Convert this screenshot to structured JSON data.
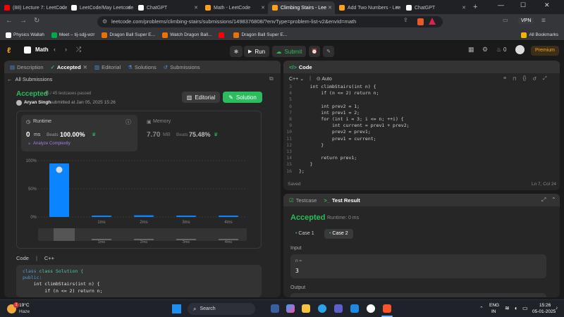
{
  "browser": {
    "tabs": [
      {
        "title": "(88) Lecture 7: LeetCode",
        "color": "#ff0000"
      },
      {
        "title": "LeetCode/May Leetcode",
        "color": "#ffffff"
      },
      {
        "title": "ChatGPT",
        "color": "#ffffff"
      },
      {
        "title": "Math - LeetCode",
        "color": "#ffa116"
      },
      {
        "title": "Climbing Stairs - Lee",
        "color": "#ffa116"
      },
      {
        "title": "Add Two Numbers - Lee",
        "color": "#ffa116"
      },
      {
        "title": "ChatGPT",
        "color": "#ffffff"
      }
    ],
    "active_tab": 4,
    "url": "leetcode.com/problems/climbing-stairs/submissions/1498376808/?envType=problem-list-v2&envId=math",
    "vpn": "VPN",
    "bookmarks": [
      "Physics Wallah",
      "Meet – tij-sdjj-wzr",
      "Dragon Ball Super E...",
      "Watch Dragon Ball...",
      "",
      "Dragon Ball Super E..."
    ],
    "all_bookmarks": "All Bookmarks"
  },
  "lc_header": {
    "title": "Math",
    "run": "Run",
    "submit": "Submit",
    "fire_count": "0",
    "premium": "Premium"
  },
  "left_panel": {
    "tabs": [
      "Description",
      "Accepted",
      "Editorial",
      "Solutions",
      "Submissions"
    ],
    "all_submissions": "All Submissions",
    "status": "Accepted",
    "testcases": "45 / 45 testcases passed",
    "user": "Aryan Singh",
    "submitted_at": "submitted at Jan 05, 2025 15:26",
    "editorial_btn": "Editorial",
    "solution_btn": "Solution",
    "runtime_label": "Runtime",
    "runtime_value": "0",
    "runtime_unit": "ms",
    "runtime_beats_label": "Beats",
    "runtime_beats": "100.00%",
    "analyze": "Analyze Complexity",
    "memory_label": "Memory",
    "memory_value": "7.70",
    "memory_unit": "MB",
    "memory_beats_label": "Beats",
    "memory_beats": "75.48%",
    "code_label": "Code",
    "code_lang": "C++",
    "code_lines": [
      "class Solution {",
      "public:",
      "    int climbStairs(int n) {",
      "        if (n <= 2) return n;"
    ]
  },
  "chart_data": {
    "type": "bar",
    "categories": [
      "",
      "1ms",
      "2ms",
      "3ms",
      "4ms"
    ],
    "values": [
      95,
      2,
      3,
      2,
      2
    ],
    "yticks": [
      "100%",
      "50%",
      "0%"
    ],
    "ylim": [
      0,
      100
    ],
    "brush_labels": [
      "1ms",
      "2ms",
      "3ms",
      "4ms"
    ],
    "bar_color": "#0a84ff"
  },
  "editor": {
    "title": "Code",
    "lang": "C++",
    "mode": "Auto",
    "saved": "Saved",
    "cursor": "Ln 7, Col 24",
    "lines": [
      {
        "n": "3",
        "t": "    int climbStairs(int n) {"
      },
      {
        "n": "4",
        "t": "        if (n <= 2) return n;"
      },
      {
        "n": "5",
        "t": ""
      },
      {
        "n": "6",
        "t": "        int prev2 = 1;"
      },
      {
        "n": "7",
        "t": "        int prev1 = 2;"
      },
      {
        "n": "8",
        "t": "        for (int i = 3; i <= n; ++i) {"
      },
      {
        "n": "9",
        "t": "            int current = prev1 + prev2;"
      },
      {
        "n": "10",
        "t": "            prev2 = prev1;"
      },
      {
        "n": "11",
        "t": "            prev1 = current;"
      },
      {
        "n": "12",
        "t": "        }"
      },
      {
        "n": "13",
        "t": ""
      },
      {
        "n": "14",
        "t": "        return prev1;"
      },
      {
        "n": "15",
        "t": "    }"
      },
      {
        "n": "16",
        "t": "};"
      }
    ]
  },
  "result": {
    "tabs": [
      "Testcase",
      "Test Result"
    ],
    "status": "Accepted",
    "runtime": "Runtime: 0 ms",
    "cases": [
      "Case 1",
      "Case 2"
    ],
    "input_label": "Input",
    "var": "n =",
    "value": "3",
    "output_label": "Output"
  },
  "taskbar": {
    "temp": "19°C",
    "weather": "Haze",
    "badge": "1",
    "search": "Search",
    "lang1": "ENG",
    "lang2": "IN",
    "time": "15:26",
    "date": "05-01-2025"
  }
}
